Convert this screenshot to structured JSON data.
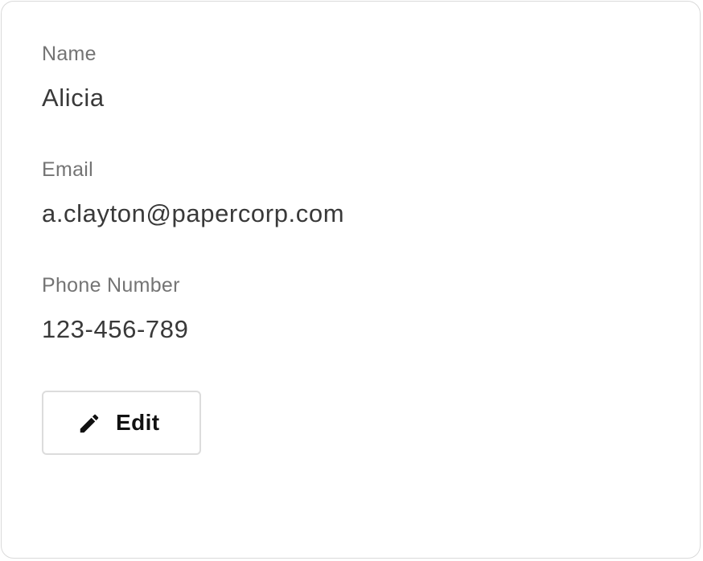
{
  "profile": {
    "name_label": "Name",
    "name_value": "Alicia",
    "email_label": "Email",
    "email_value": "a.clayton@papercorp.com",
    "phone_label": "Phone Number",
    "phone_value": "123-456-789"
  },
  "actions": {
    "edit_label": "Edit",
    "edit_icon": "pencil-icon"
  },
  "colors": {
    "label": "#747474",
    "value": "#393939",
    "border": "#dadada"
  }
}
